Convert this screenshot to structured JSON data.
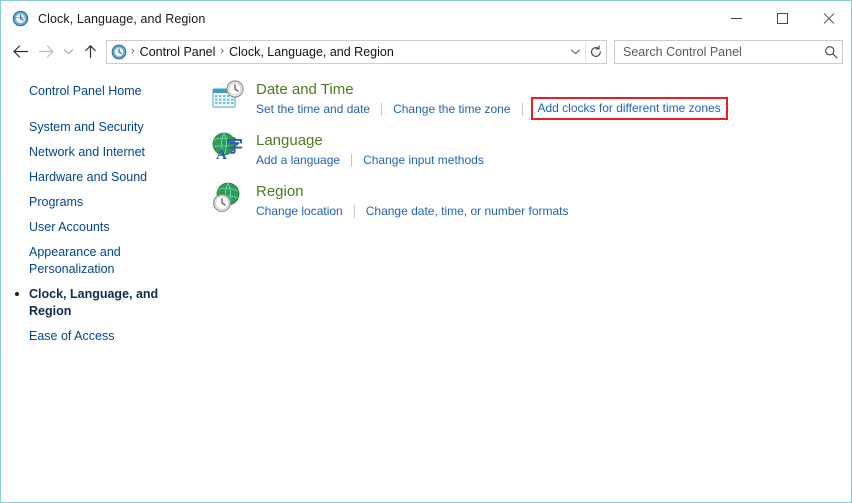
{
  "window": {
    "title": "Clock, Language, and Region",
    "title_icon": "clock-region-icon",
    "minimize_label": "Minimize",
    "maximize_label": "Maximize",
    "close_label": "Close"
  },
  "navbar": {
    "back_label": "Back",
    "forward_label": "Forward",
    "recent_label": "Recent locations",
    "up_label": "Up one level",
    "address_icon": "control-panel-icon",
    "breadcrumbs": [
      {
        "label": "Control Panel"
      },
      {
        "label": "Clock, Language, and Region"
      }
    ],
    "breadcrumb_separator": "›",
    "dropdown_icon": "chevron-down-icon",
    "refresh_icon": "refresh-icon"
  },
  "search": {
    "placeholder": "Search Control Panel",
    "value": "",
    "icon": "search-icon"
  },
  "sidebar": {
    "home": {
      "label": "Control Panel Home"
    },
    "items": [
      {
        "label": "System and Security",
        "selected": false
      },
      {
        "label": "Network and Internet",
        "selected": false
      },
      {
        "label": "Hardware and Sound",
        "selected": false
      },
      {
        "label": "Programs",
        "selected": false
      },
      {
        "label": "User Accounts",
        "selected": false
      },
      {
        "label": "Appearance and Personalization",
        "selected": false
      },
      {
        "label": "Clock, Language, and Region",
        "selected": true
      },
      {
        "label": "Ease of Access",
        "selected": false
      }
    ]
  },
  "main": {
    "categories": [
      {
        "title": "Date and Time",
        "icon": "date-and-time-icon",
        "links": [
          {
            "label": "Set the time and date",
            "highlighted": false
          },
          {
            "label": "Change the time zone",
            "highlighted": false
          },
          {
            "label": "Add clocks for different time zones",
            "highlighted": true
          }
        ]
      },
      {
        "title": "Language",
        "icon": "language-icon",
        "links": [
          {
            "label": "Add a language",
            "highlighted": false
          },
          {
            "label": "Change input methods",
            "highlighted": false
          }
        ]
      },
      {
        "title": "Region",
        "icon": "region-icon",
        "links": [
          {
            "label": "Change location",
            "highlighted": false
          },
          {
            "label": "Change date, time, or number formats",
            "highlighted": false
          }
        ]
      }
    ]
  },
  "colors": {
    "window_border": "#8ecad4",
    "category_title": "#4a7c20",
    "link": "#1f63b5",
    "sidebar_link": "#00468c",
    "highlight_box": "#ec1c24"
  }
}
